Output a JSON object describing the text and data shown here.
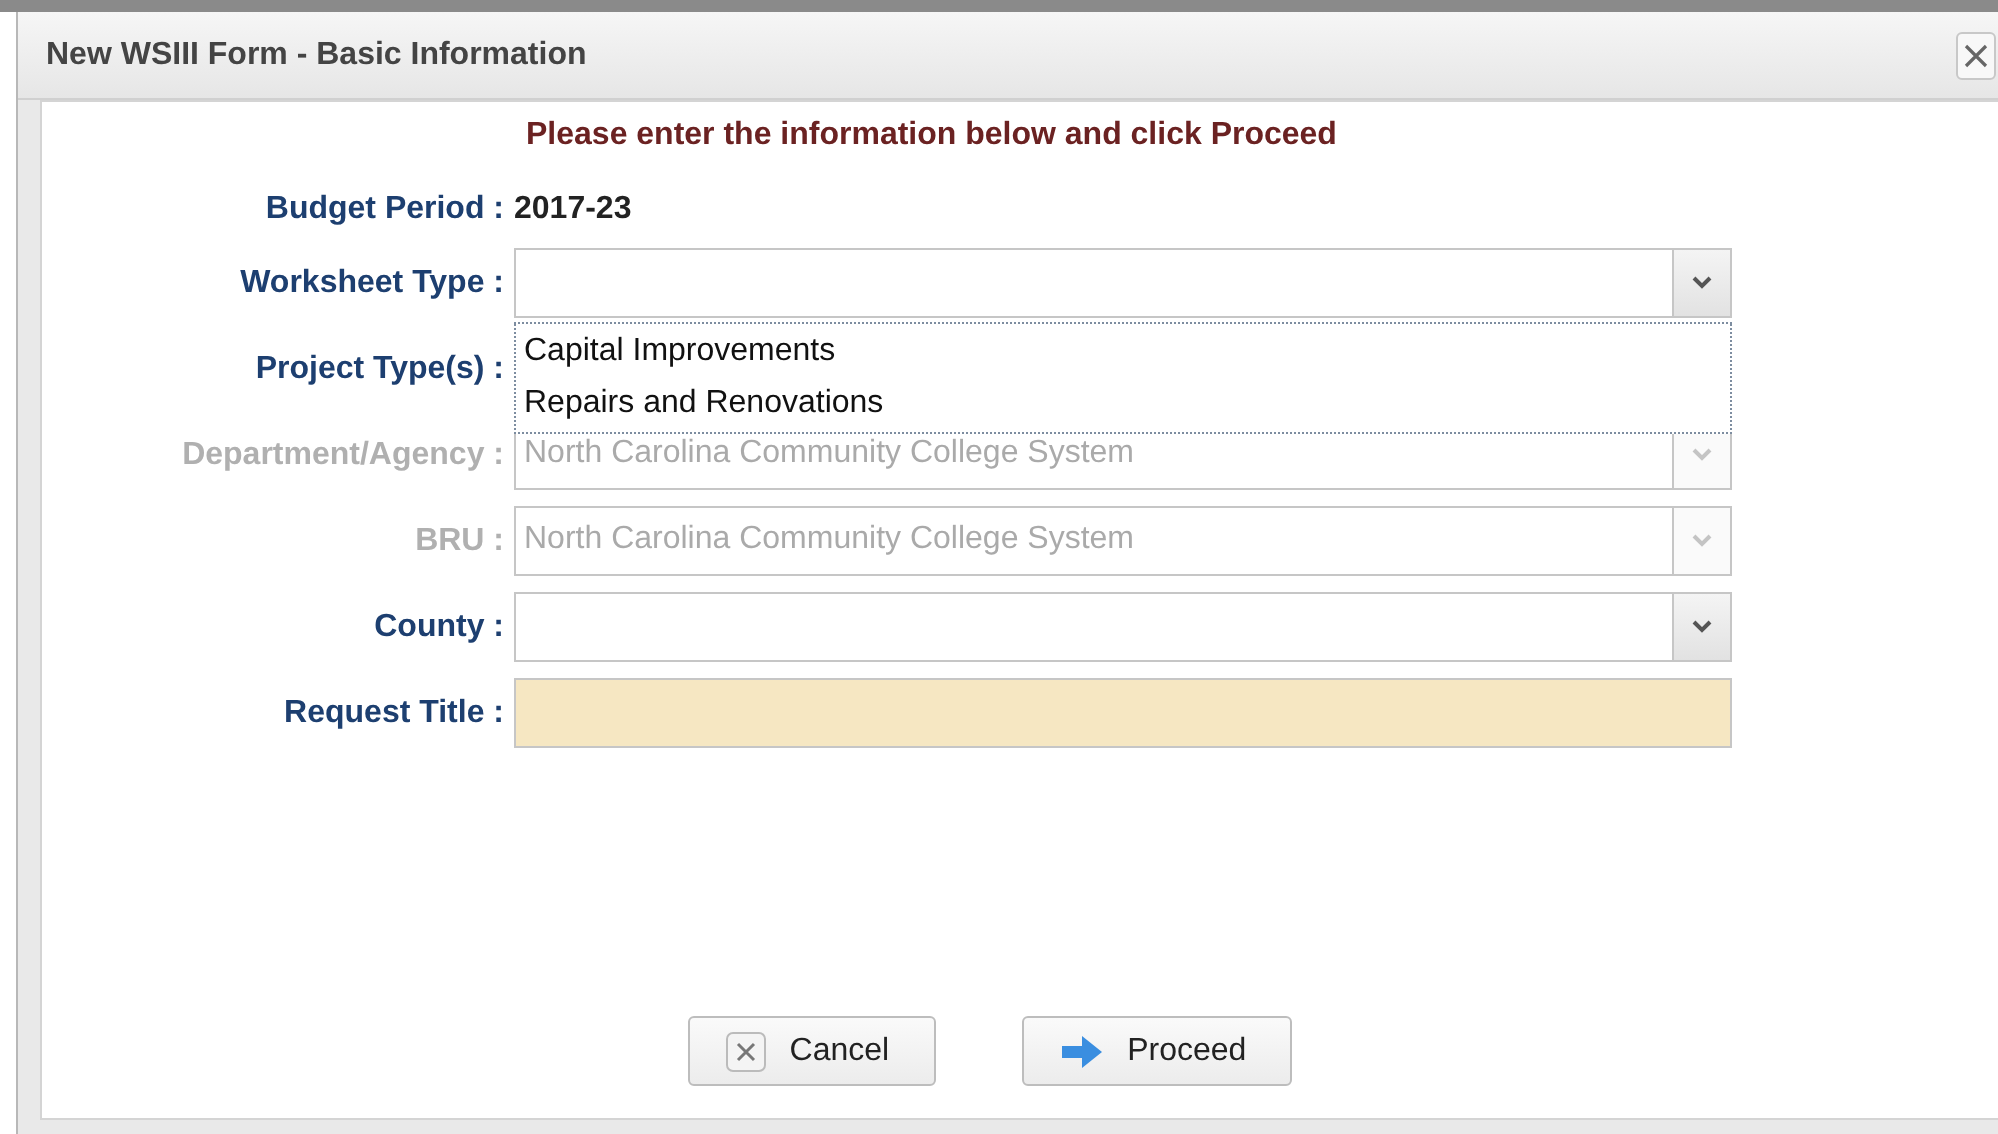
{
  "window": {
    "title": "New WSIII Form - Basic Information"
  },
  "message": "Please enter the information below and click Proceed",
  "fields": [
    {
      "kind": "static",
      "label": "Budget Period :",
      "value": "2017-23"
    },
    {
      "kind": "select",
      "label": "Worksheet Type :",
      "disabled": false,
      "expanded": true,
      "options": [
        "Capital Improvements",
        "Repairs and Renovations"
      ]
    },
    {
      "kind": "covered",
      "label": "Project Type(s) :"
    },
    {
      "kind": "select",
      "label": "Department/Agency :",
      "disabled": true,
      "value": "North Carolina Community College System"
    },
    {
      "kind": "select",
      "label": "BRU :",
      "disabled": true,
      "value": "North Carolina Community College System"
    },
    {
      "kind": "select",
      "label": "County :",
      "disabled": false
    },
    {
      "kind": "text",
      "label": "Request Title :",
      "required": true
    }
  ],
  "buttons": [
    {
      "kind": "cancel",
      "label": "Cancel"
    },
    {
      "kind": "proceed",
      "label": "Proceed"
    }
  ]
}
